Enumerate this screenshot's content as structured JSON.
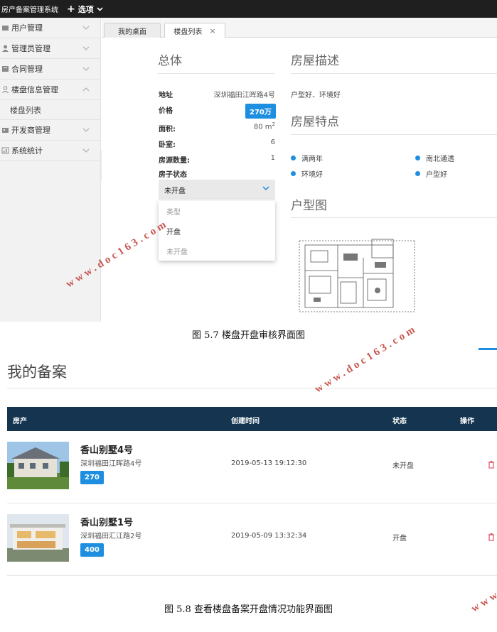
{
  "fig1": {
    "app_title": "房产备案管理系统",
    "options_label": "选项",
    "sidebar": [
      {
        "label": "用户管理",
        "icon": "user-group-icon"
      },
      {
        "label": "管理员管理",
        "icon": "admin-icon"
      },
      {
        "label": "合同管理",
        "icon": "contract-icon"
      },
      {
        "label": "楼盘信息管理",
        "icon": "building-user-icon",
        "expanded": true,
        "sub": [
          "楼盘列表"
        ]
      },
      {
        "label": "开发商管理",
        "icon": "developer-icon"
      },
      {
        "label": "系统统计",
        "icon": "stats-icon"
      }
    ],
    "tabs": [
      {
        "label": "我的桌面",
        "active": false
      },
      {
        "label": "楼盘列表",
        "active": true,
        "close": "×"
      }
    ],
    "overview": {
      "title": "总体",
      "address_label": "地址",
      "address_value": "深圳福田江晖路4号",
      "price_label": "价格",
      "price_value": "270万",
      "area_label": "面积:",
      "area_value": "80 m",
      "area_unit_sup": "2",
      "bedroom_label": "卧室:",
      "bedroom_value": "6",
      "count_label": "房源数量:",
      "count_value": "1",
      "status_label": "房子状态",
      "status_selected": "未开盘",
      "status_options": [
        "类型",
        "开盘",
        "未开盘"
      ]
    },
    "description": {
      "title": "房屋描述",
      "text": "户型好、环境好"
    },
    "features": {
      "title": "房屋特点",
      "items": [
        "满两年",
        "南北通透",
        "环境好",
        "户型好"
      ]
    },
    "floorplan": {
      "title": "户型图"
    },
    "caption": "图 5.7 楼盘开盘审核界面图"
  },
  "fig2": {
    "title": "我的备案",
    "headers": [
      "房产",
      "创建时间",
      "状态",
      "操作"
    ],
    "rows": [
      {
        "name": "香山别墅4号",
        "address": "深圳福田江晖路4号",
        "price": "270",
        "created": "2019-05-13 19:12:30",
        "status": "未开盘"
      },
      {
        "name": "香山别墅1号",
        "address": "深圳福田汇江路2号",
        "price": "400",
        "created": "2019-05-09 13:32:34",
        "status": "开盘"
      }
    ],
    "caption": "图 5.8 查看楼盘备案开盘情况功能界面图"
  },
  "watermark": "www.doc163.com",
  "colors": {
    "accent": "#1e8fe0",
    "header_bg": "#14344f",
    "topbar_bg": "#1f1f1f",
    "delete": "#e05060",
    "watermark": "#c2453f"
  }
}
